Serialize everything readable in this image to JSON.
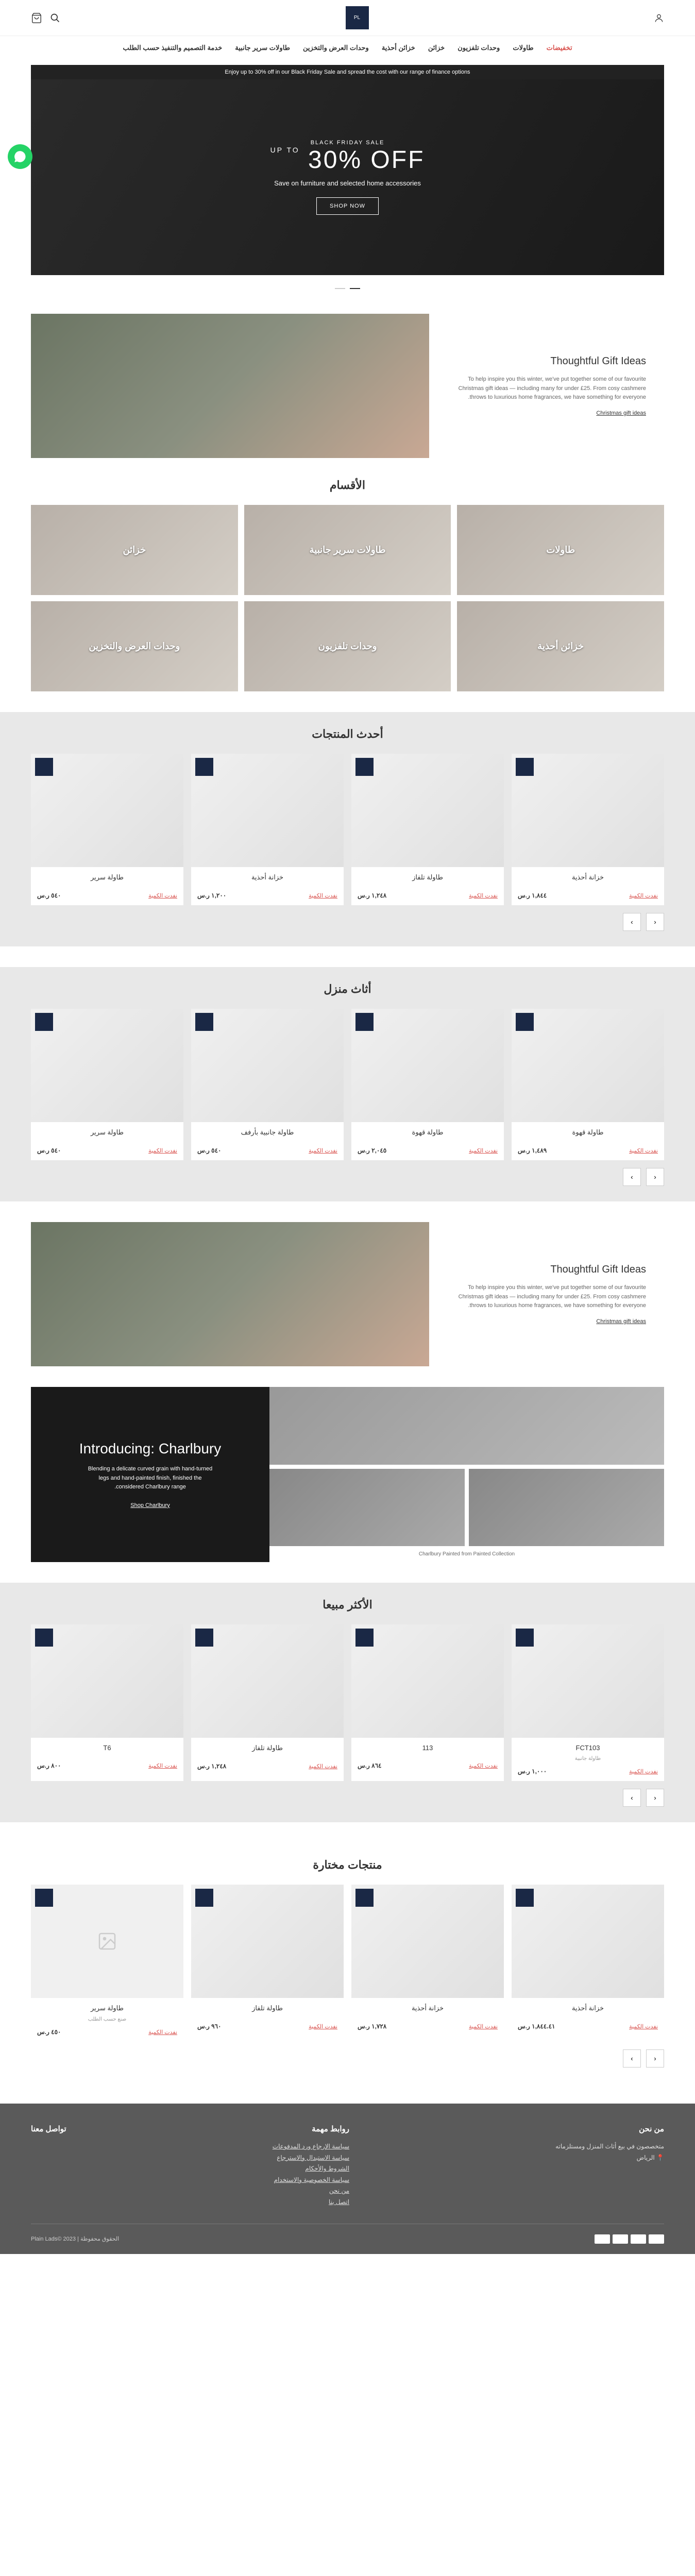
{
  "header": {
    "nav": [
      "تخفيضات",
      "طاولات",
      "وحدات تلفزيون",
      "خزائن",
      "خزائن أحذية",
      "وحدات العرض والتخزين",
      "طاولات سرير جانبية",
      "خدمة التصميم والتنفيذ حسب الطلب"
    ]
  },
  "hero": {
    "banner": "Enjoy up to 30% off in our Black Friday Sale and spread the cost with our range of finance options",
    "upto": "UP TO",
    "title_top": "BLACK FRIDAY SALE",
    "title": "30% OFF",
    "sub": "Save on furniture and selected home accessories",
    "btn": "SHOP NOW"
  },
  "promo1": {
    "title": "Thoughtful Gift Ideas",
    "text": "To help inspire you this winter, we've put together some of our favourite Christmas gift ideas — including many for under £25. From cosy cashmere throws to luxurious home fragrances, we have something for everyone.",
    "link": "Christmas gift ideas"
  },
  "categories": {
    "title": "الأقسام",
    "items": [
      "طاولات",
      "طاولات سرير جانبية",
      "خزائن",
      "خزائن أحذية",
      "وحدات تلفزيون",
      "وحدات العرض والتخزين"
    ]
  },
  "latest": {
    "title": "أحدث المنتجات",
    "items": [
      {
        "name": "خزانة أحذية",
        "price": "١,٨٤٤ ر.س",
        "cart": "نفدت الكمية"
      },
      {
        "name": "طاولة تلفاز",
        "price": "١,٢٤٨ ر.س",
        "cart": "نفدت الكمية"
      },
      {
        "name": "خزانة أحذية",
        "price": "١,٢٠٠ ر.س",
        "cart": "نفدت الكمية"
      },
      {
        "name": "طاولة سرير",
        "price": "٥٤٠ ر.س",
        "cart": "نفدت الكمية"
      }
    ]
  },
  "home_furniture": {
    "title": "أثاث منزل",
    "items": [
      {
        "name": "طاولة قهوة",
        "price": "١,٤٨٩ ر.س",
        "cart": "نفدت الكمية"
      },
      {
        "name": "طاولة قهوة",
        "price": "٢,٠٤٥ ر.س",
        "cart": "نفدت الكمية"
      },
      {
        "name": "طاولة جانبية بأرفف",
        "price": "٥٤٠ ر.س",
        "cart": "نفدت الكمية"
      },
      {
        "name": "طاولة سرير",
        "price": "٥٤٠ ر.س",
        "cart": "نفدت الكمية"
      }
    ]
  },
  "charlbury": {
    "title": "Introducing: Charlbury",
    "text": "Blending a delicate curved grain with hand-turned legs and hand-painted finish, finished the considered Charlbury range.",
    "link": "Shop Charlbury",
    "caption": "Charlbury Painted from Painted Collection"
  },
  "bestsellers": {
    "title": "الأكثر مبيعا",
    "items": [
      {
        "name": "FCT103",
        "sub": "طاولة جانبية",
        "price": "١,٠٠٠ ر.س",
        "cart": "نفدت الكمية"
      },
      {
        "name": "113",
        "price": "٨٦٤ ر.س",
        "cart": "نفدت الكمية"
      },
      {
        "name": "طاولة تلفاز",
        "price": "١,٢٤٨ ر.س",
        "cart": "نفدت الكمية"
      },
      {
        "name": "T6",
        "price": "٨٠٠ ر.س",
        "cart": "نفدت الكمية"
      }
    ]
  },
  "featured": {
    "title": "منتجات مختارة",
    "items": [
      {
        "name": "خزانة أحذية",
        "price": "١,٨٤٤.٤١ ر.س",
        "cart": "نفدت الكمية",
        "placeholder": false
      },
      {
        "name": "خزانة أحذية",
        "price": "١,٧٢٨ ر.س",
        "cart": "نفدت الكمية",
        "placeholder": false
      },
      {
        "name": "طاولة تلفاز",
        "price": "٩٦٠ ر.س",
        "cart": "نفدت الكمية",
        "placeholder": false
      },
      {
        "name": "طاولة سرير",
        "sub": "صنع حسب الطلب",
        "price": "٤٥٠ ر.س",
        "cart": "نفدت الكمية",
        "placeholder": true
      }
    ]
  },
  "footer": {
    "about_title": "من نحن",
    "about_text": "متخصصون في بيع أثاث المنزل ومستلزماته",
    "location": "الرياض",
    "links_title": "روابط مهمة",
    "links": [
      "سياسة الإرجاع ورد المدفوعات",
      "سياسة الاستبدال والاسترجاع",
      "الشروط والأحكام",
      "سياسة الخصوصية والاستخدام",
      "من نحن",
      "اتصل بنا"
    ],
    "contact_title": "تواصل معنا",
    "copyright": "الحقوق محفوظة | 2023 ©Plain Lads"
  }
}
